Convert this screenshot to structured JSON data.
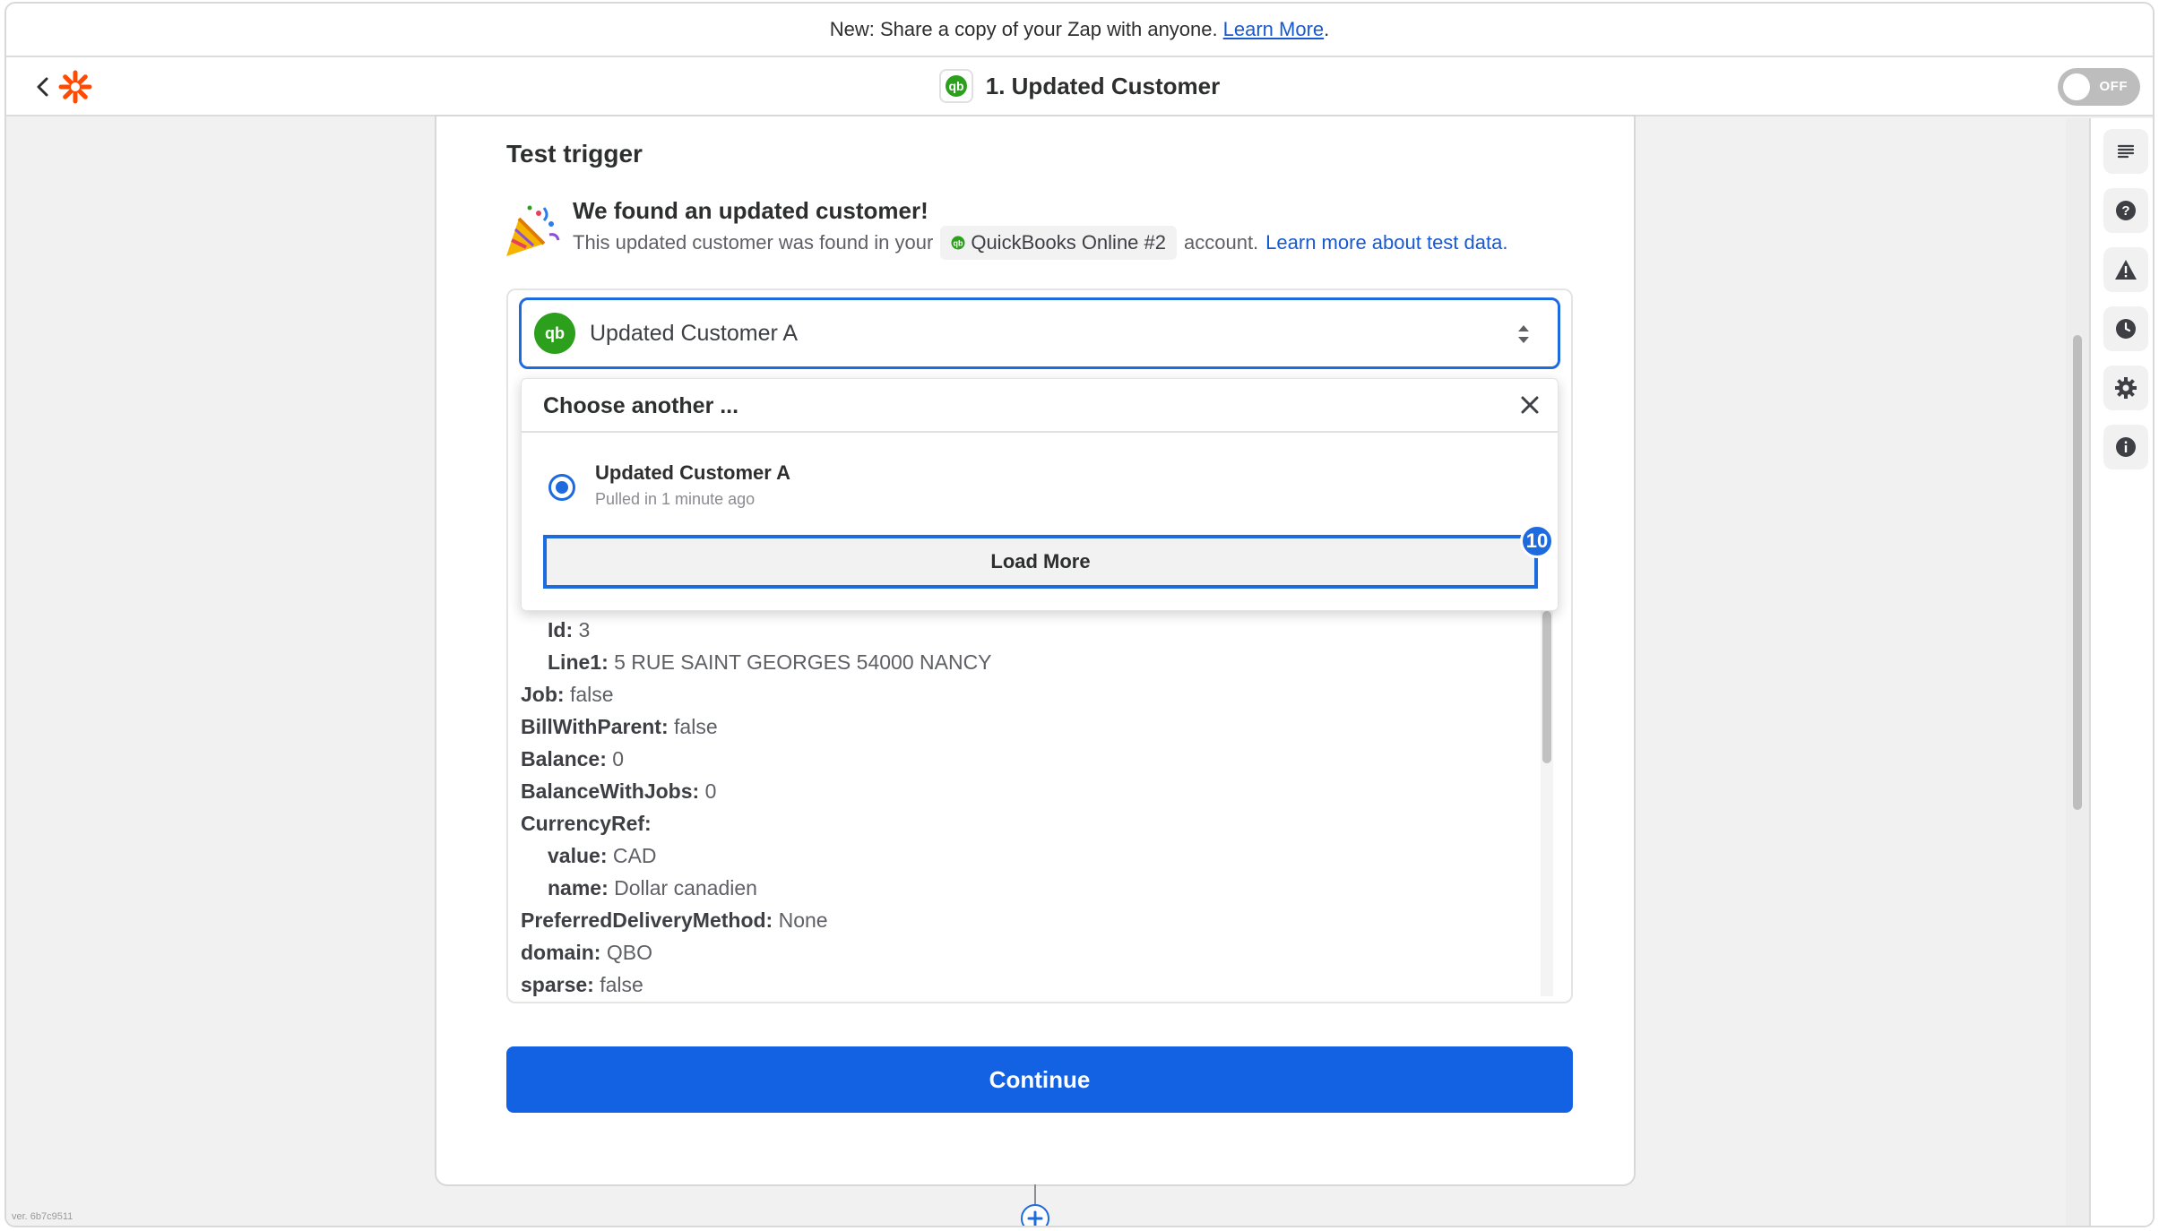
{
  "banner": {
    "text": "New: Share a copy of your Zap with anyone.",
    "link": "Learn More",
    "trailing": "."
  },
  "header": {
    "title": "1. Updated Customer",
    "toggle_label": "OFF",
    "back_icon": "chevron-left-icon",
    "logo_icon": "zapier-logo",
    "accent": "#ff4a00"
  },
  "trigger": {
    "section_title": "Test trigger",
    "found_title": "We found an updated customer!",
    "found_desc_prefix": "This updated customer was found in your",
    "account_name": "QuickBooks Online #2",
    "found_desc_suffix": "account.",
    "learn_more_link": "Learn more about test data."
  },
  "selector": {
    "selected": "Updated Customer A",
    "app_icon": "quickbooks-icon",
    "brand_color": "#2ca01c"
  },
  "dropdown": {
    "title": "Choose another ...",
    "options": [
      {
        "title": "Updated Customer A",
        "subtitle": "Pulled in 1 minute ago"
      }
    ],
    "load_more_label": "Load More",
    "badge_count": "10"
  },
  "fields": [
    {
      "key": "Id:",
      "value": "3"
    },
    {
      "key": "Line1:",
      "value": "5 RUE SAINT GEORGES 54000 NANCY"
    },
    {
      "key": "Job:",
      "value": "false"
    },
    {
      "key": "BillWithParent:",
      "value": "false"
    },
    {
      "key": "Balance:",
      "value": "0"
    },
    {
      "key": "BalanceWithJobs:",
      "value": "0"
    },
    {
      "key": "CurrencyRef:",
      "value": ""
    },
    {
      "key": "value:",
      "value": "CAD"
    },
    {
      "key": "name:",
      "value": "Dollar canadien"
    },
    {
      "key": "PreferredDeliveryMethod:",
      "value": "None"
    },
    {
      "key": "domain:",
      "value": "QBO"
    },
    {
      "key": "sparse:",
      "value": "false"
    }
  ],
  "continue_label": "Continue",
  "version_text": "ver. 6b7c9511",
  "rail_icons": [
    "notes-icon",
    "help-icon",
    "alert-icon",
    "history-icon",
    "settings-icon",
    "info-icon"
  ],
  "colors": {
    "primary": "#1462e4",
    "link": "#1759d0"
  }
}
